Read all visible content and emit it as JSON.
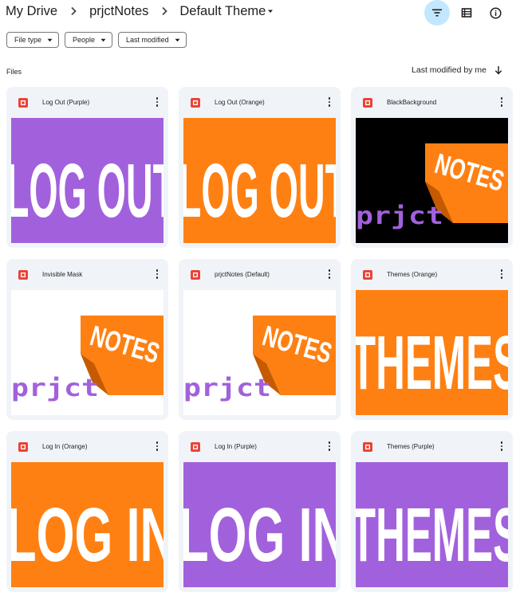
{
  "breadcrumb": {
    "items": [
      "My Drive",
      "prjctNotes"
    ],
    "current": "Default Theme"
  },
  "header_actions": [
    "filter-icon",
    "list-view-icon",
    "info-icon"
  ],
  "filters": [
    "File type",
    "People",
    "Last modified"
  ],
  "section_label": "Files",
  "sort_label": "Last modified by me",
  "colors": {
    "purple": "#a261dc",
    "orange": "#ff8012",
    "black": "#000000",
    "white": "#ffffff",
    "slides_red": "#ea4335"
  },
  "files": [
    {
      "title": "Log Out (Purple)",
      "thumb_text": "LOG OUT",
      "thumb": "text-purple"
    },
    {
      "title": "Log Out (Orange)",
      "thumb_text": "LOG OUT",
      "thumb": "text-orange"
    },
    {
      "title": "BlackBackground",
      "thumb_text": "NOTES",
      "thumb_word": "prjct",
      "thumb": "logo-black"
    },
    {
      "title": "Invisible Mask",
      "thumb_text": "NOTES",
      "thumb_word": "prjct",
      "thumb": "logo-white"
    },
    {
      "title": "prjctNotes (Default)",
      "thumb_text": "NOTES",
      "thumb_word": "prjct",
      "thumb": "logo-white"
    },
    {
      "title": "Themes (Orange)",
      "thumb_text": "THEMES",
      "thumb": "text-orange"
    },
    {
      "title": "Log In (Orange)",
      "thumb_text": "LOG IN",
      "thumb": "text-orange"
    },
    {
      "title": "Log In (Purple)",
      "thumb_text": "LOG IN",
      "thumb": "text-purple"
    },
    {
      "title": "Themes (Purple)",
      "thumb_text": "THEMES",
      "thumb": "text-purple"
    }
  ]
}
